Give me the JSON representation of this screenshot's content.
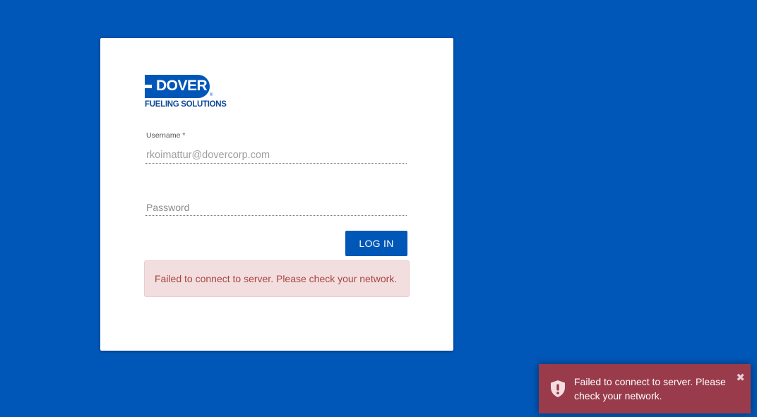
{
  "brand": {
    "name": "DOVER",
    "registered_mark": "®",
    "tagline": "FUELING SOLUTIONS",
    "color": "#0057b8"
  },
  "login_form": {
    "username_label": "Username *",
    "username_value": "rkoimattur@dovercorp.com",
    "password_placeholder": "Password",
    "login_button_label": "LOG IN",
    "error_message": "Failed to connect to server. Please check your network."
  },
  "toast": {
    "icon": "shield-alert-icon",
    "message": "Failed to connect to server. Please check your network.",
    "close_icon": "close-icon",
    "close_glyph": "✖",
    "background_color": "#993b4b"
  },
  "colors": {
    "page_background": "#0057b8",
    "primary_button": "#0057b8",
    "alert_background": "#f2dede",
    "alert_text": "#a94442"
  }
}
